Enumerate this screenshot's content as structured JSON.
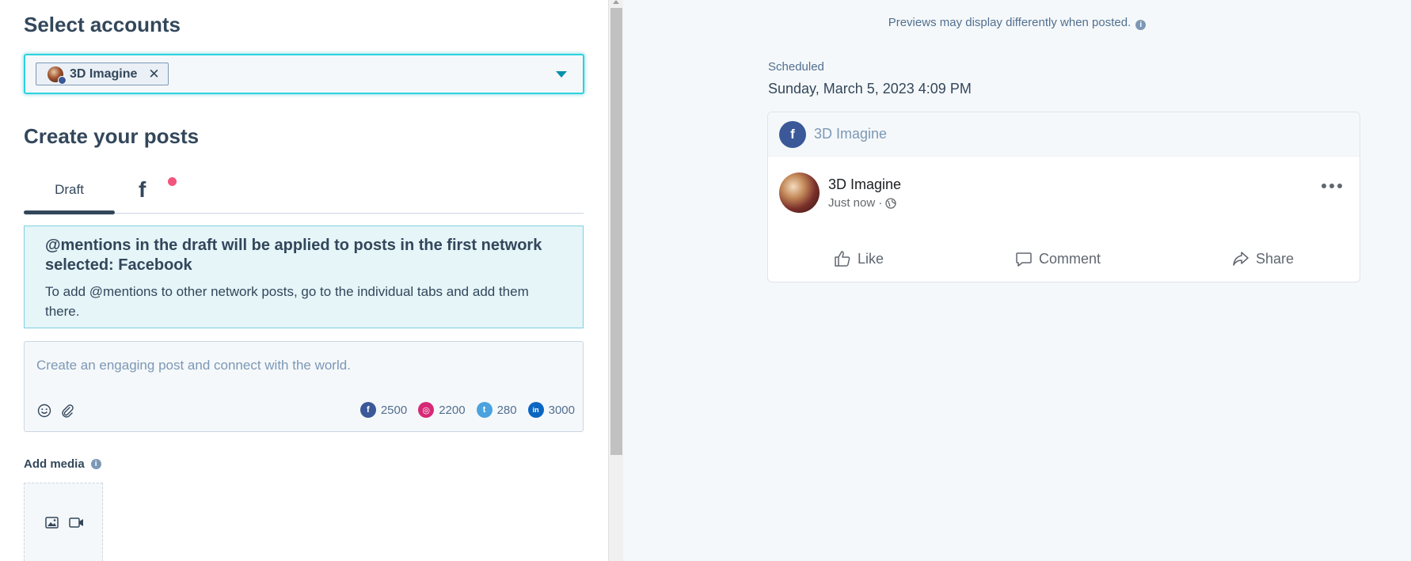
{
  "left": {
    "select_accounts_title": "Select accounts",
    "selected_account_chip": "3D Imagine",
    "chip_remove": "✕",
    "create_posts_title": "Create your posts",
    "tabs": [
      {
        "label": "Draft",
        "active": true
      },
      {
        "label": "f",
        "network": "facebook",
        "has_notification": true
      }
    ],
    "alert": {
      "title": "@mentions in the draft will be applied to posts in the first network selected: Facebook",
      "body": "To add @mentions to other network posts, go to the individual tabs and add them there."
    },
    "composer": {
      "placeholder": "Create an engaging post and connect with the world.",
      "char_limits": [
        {
          "network": "facebook",
          "icon": "f",
          "color": "#3b5998",
          "limit": "2500"
        },
        {
          "network": "instagram",
          "icon": "◎",
          "color": "#d62976",
          "limit": "2200"
        },
        {
          "network": "twitter",
          "icon": "t",
          "color": "#4aa3df",
          "limit": "280"
        },
        {
          "network": "linkedin",
          "icon": "in",
          "color": "#0a66c2",
          "limit": "3000"
        }
      ]
    },
    "add_media_label": "Add media",
    "info_icon": "i"
  },
  "right": {
    "preview_note": "Previews may display differently when posted.",
    "scheduled_label": "Scheduled",
    "scheduled_date": "Sunday, March 5, 2023 4:09 PM",
    "card": {
      "header_network_icon": "f",
      "header_account": "3D Imagine",
      "post_account": "3D Imagine",
      "post_meta": "Just now ·",
      "actions": {
        "like": "Like",
        "comment": "Comment",
        "share": "Share"
      }
    }
  },
  "colors": {
    "accent_border": "#2ad4e0",
    "facebook": "#3b5998",
    "notification_dot": "#f2547d",
    "alert_bg": "#e5f5f8"
  }
}
